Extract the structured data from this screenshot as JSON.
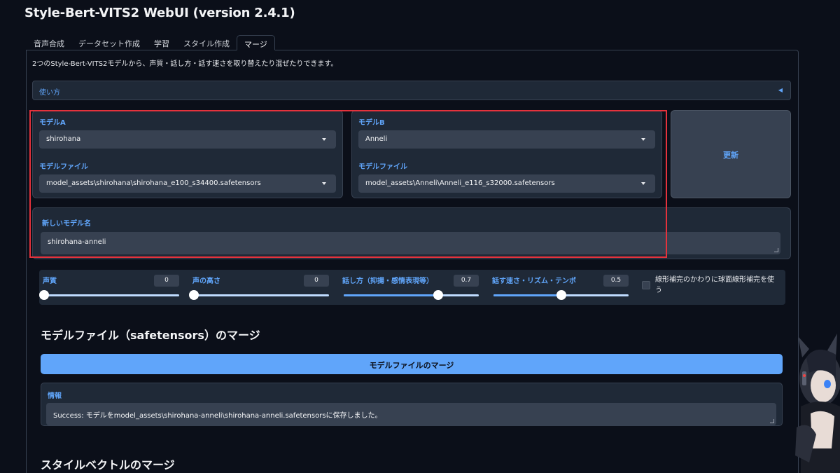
{
  "app": {
    "title": "Style-Bert-VITS2 WebUI (version 2.4.1)"
  },
  "tabs": [
    {
      "label": "音声合成"
    },
    {
      "label": "データセット作成"
    },
    {
      "label": "学習"
    },
    {
      "label": "スタイル作成"
    },
    {
      "label": "マージ"
    }
  ],
  "active_tab": "マージ",
  "merge": {
    "description": "2つのStyle-Bert-VITS2モデルから、声質・話し方・話す速さを取り替えたり混ぜたりできます。",
    "usage_accordion": {
      "label": "使い方",
      "arrow": "◀"
    },
    "model_a": {
      "label": "モデルA",
      "value": "shirohana",
      "file_label": "モデルファイル",
      "file_value": "model_assets\\shirohana\\shirohana_e100_s34400.safetensors"
    },
    "model_b": {
      "label": "モデルB",
      "value": "Anneli",
      "file_label": "モデルファイル",
      "file_value": "model_assets\\Anneli\\Anneli_e116_s32000.safetensors"
    },
    "update_button": "更新",
    "new_model_name": {
      "label": "新しいモデル名",
      "value": "shirohana-anneli"
    },
    "sliders": [
      {
        "label": "声質",
        "value": "0",
        "fraction": 0.0
      },
      {
        "label": "声の高さ",
        "value": "0",
        "fraction": 0.0
      },
      {
        "label": "話し方（抑揚・感情表現等）",
        "value": "0.7",
        "fraction": 0.7
      },
      {
        "label": "話す速さ・リズム・テンポ",
        "value": "0.5",
        "fraction": 0.5
      }
    ],
    "slerp_checkbox": {
      "label": "線形補完のかわりに球面線形補完を使う",
      "checked": false
    },
    "model_file_section": {
      "heading": "モデルファイル（safetensors）のマージ",
      "button": "モデルファイルのマージ",
      "info_label": "情報",
      "info_value": "Success: モデルをmodel_assets\\shirohana-anneli\\shirohana-anneli.safetensorsに保存しました。"
    },
    "style_vector_section": {
      "heading": "スタイルベクトルのマージ"
    }
  },
  "colors": {
    "accent": "#60a5fa",
    "background": "#0b0f19",
    "panel": "#1f2937",
    "input": "#374151",
    "highlight": "#e5323c"
  }
}
